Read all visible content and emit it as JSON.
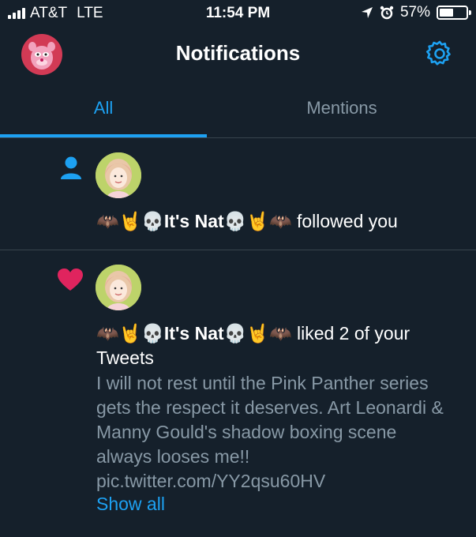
{
  "status_bar": {
    "carrier": "AT&T",
    "network": "LTE",
    "time": "11:54 PM",
    "battery": "57%",
    "battery_level": 0.57
  },
  "header": {
    "title": "Notifications",
    "avatar_icon": "pink-panther-avatar",
    "settings_icon": "gear-icon"
  },
  "tabs": [
    {
      "label": "All",
      "active": true
    },
    {
      "label": "Mentions",
      "active": false
    }
  ],
  "notifications": [
    {
      "type": "follow",
      "icon": "person-icon",
      "user_name": "🦇🤘💀It's Nat💀🤘🦇",
      "action": "followed you"
    },
    {
      "type": "like",
      "icon": "heart-icon",
      "user_name": "🦇🤘💀It's Nat💀🤘🦇",
      "action": "liked 2 of your Tweets",
      "tweet_text": "I will not rest until the Pink Panther series gets the respect it deserves. Art Leonardi & Manny Gould's shadow boxing scene always looses me!! pic.twitter.com/YY2qsu60HV",
      "show_all": "Show all"
    }
  ],
  "colors": {
    "background": "#15202b",
    "accent": "#1da1f2",
    "muted": "#8899a6",
    "divider": "#38444d",
    "like": "#e0245e"
  }
}
